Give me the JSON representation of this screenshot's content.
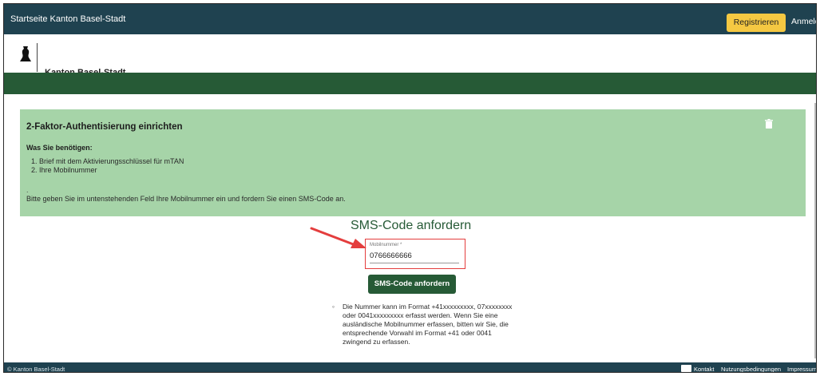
{
  "topbar": {
    "home_link": "Startseite Kanton Basel-Stadt",
    "register_label": "Registrieren",
    "login_label": "Anmelden"
  },
  "header": {
    "site_title": "Kanton Basel-Stadt"
  },
  "info_box": {
    "heading": "2-Faktor-Authentisierung einrichten",
    "need_heading": "Was Sie benötigen:",
    "items": [
      "1. Brief mit dem Aktivierungsschlüssel für mTAN",
      "2. Ihre Mobilnummer"
    ],
    "dot": ".",
    "instruction": "Bitte geben Sie im untenstehenden Feld Ihre Mobilnummer ein und fordern Sie einen SMS-Code an."
  },
  "sms": {
    "title": "SMS-Code anfordern",
    "field_label": "Mobilnummer *",
    "field_value": "0766666666",
    "submit_label": "SMS-Code anfordern",
    "hint": "Die Nummer kann im Format +41xxxxxxxxx, 07xxxxxxxx oder 0041xxxxxxxxx erfasst werden. Wenn Sie eine ausländische Mobilnummer erfassen, bitten wir Sie, die entsprechende Vorwahl im Format +41 oder 0041 zwingend zu erfassen."
  },
  "footer": {
    "copyright": "© Kanton Basel-Stadt",
    "contact": "Kontakt",
    "terms": "Nutzungsbedingungen",
    "imprint": "Impressum"
  },
  "colors": {
    "topbar": "#1f4250",
    "brand_green": "#265a36",
    "info_bg": "#a6d4a8",
    "register_btn": "#f5c842",
    "annotation_red": "#e43d3d"
  },
  "icons": [
    "basel-crest-icon",
    "trash-icon",
    "contact-card-icon",
    "annotation-arrow-icon"
  ]
}
